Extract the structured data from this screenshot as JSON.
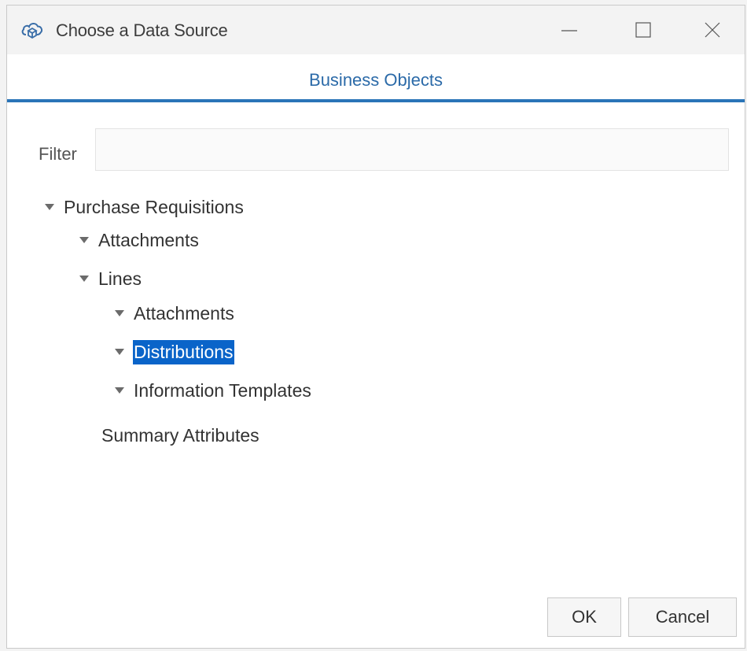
{
  "window": {
    "title": "Choose a Data Source",
    "icon": "cloud-data-icon"
  },
  "tab": {
    "label": "Business Objects",
    "accent": "#2a74b8"
  },
  "filter": {
    "label": "Filter",
    "value": "",
    "placeholder": ""
  },
  "tree": {
    "root": {
      "label": "Purchase Requisitions",
      "expanded": true
    },
    "attachments": {
      "label": "Attachments",
      "expanded": true
    },
    "lines": {
      "label": "Lines",
      "expanded": true
    },
    "lines_attachments": {
      "label": "Attachments",
      "expanded": true
    },
    "distributions": {
      "label": "Distributions",
      "expanded": true,
      "selected": true
    },
    "information_templates": {
      "label": "Information Templates",
      "expanded": true
    },
    "summary_attributes": {
      "label": "Summary Attributes"
    }
  },
  "buttons": {
    "ok": "OK",
    "cancel": "Cancel"
  },
  "colors": {
    "selection": "#0a64c9",
    "tab_text": "#2b6aa8"
  }
}
